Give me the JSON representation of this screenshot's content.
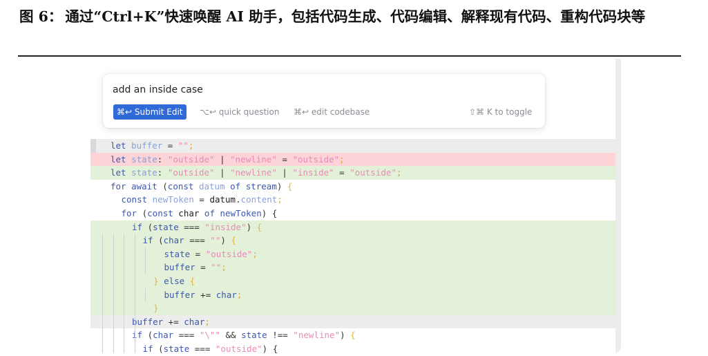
{
  "caption": {
    "prefix": "图 6：",
    "text": "通过“Ctrl+K”快速唤醒 AI 助手，包括代码生成、代码编辑、解释现有代码、重构代码块等"
  },
  "prompt": {
    "input_value": "add an inside case",
    "submit_label": "⌘↩ Submit Edit",
    "quick_question": "⌥↩ quick question",
    "edit_codebase": "⌘↩ edit codebase",
    "toggle_hint": "⇧⌘ K to toggle"
  },
  "code_lines": [
    {
      "bg": "gray",
      "indent": 0,
      "gutter": true,
      "guides": 0,
      "tokens": [
        [
          "kw",
          "let "
        ],
        [
          "var",
          "buffer"
        ],
        [
          "op",
          " = "
        ],
        [
          "str",
          "\"\""
        ],
        [
          "punct",
          ";"
        ]
      ]
    },
    {
      "bg": "red",
      "indent": 0,
      "gutter": false,
      "guides": 0,
      "tokens": [
        [
          "kw",
          "let "
        ],
        [
          "var",
          "state"
        ],
        [
          "op",
          ": "
        ],
        [
          "str",
          "\"outside\""
        ],
        [
          "op",
          " | "
        ],
        [
          "str",
          "\"newline\""
        ],
        [
          "op",
          " = "
        ],
        [
          "str",
          "\"outside\""
        ],
        [
          "punct",
          ";"
        ]
      ]
    },
    {
      "bg": "green",
      "indent": 0,
      "gutter": false,
      "guides": 0,
      "tokens": [
        [
          "kw",
          "let "
        ],
        [
          "var",
          "state"
        ],
        [
          "op",
          ": "
        ],
        [
          "str",
          "\"outside\""
        ],
        [
          "op",
          " | "
        ],
        [
          "str",
          "\"newline\""
        ],
        [
          "op",
          " | "
        ],
        [
          "str",
          "\"inside\""
        ],
        [
          "op",
          " = "
        ],
        [
          "str",
          "\"outside\""
        ],
        [
          "punct",
          ";"
        ]
      ]
    },
    {
      "bg": "plain",
      "indent": 0,
      "gutter": false,
      "guides": 0,
      "tokens": [
        [
          "kw",
          "for await "
        ],
        [
          "op",
          "("
        ],
        [
          "kw",
          "const "
        ],
        [
          "var",
          "datum"
        ],
        [
          "kw",
          " of "
        ],
        [
          "kw",
          "stream"
        ],
        [
          "op",
          ") "
        ],
        [
          "brace",
          "{"
        ]
      ]
    },
    {
      "bg": "plain",
      "indent": 1,
      "gutter": false,
      "guides": 0,
      "tokens": [
        [
          "kw",
          "const "
        ],
        [
          "var",
          "newToken"
        ],
        [
          "op",
          " = "
        ],
        [
          "id",
          "datum"
        ],
        [
          "op",
          "."
        ],
        [
          "var",
          "content"
        ],
        [
          "punct",
          ";"
        ]
      ]
    },
    {
      "bg": "plain",
      "indent": 1,
      "gutter": false,
      "guides": 0,
      "tokens": [
        [
          "kw",
          "for "
        ],
        [
          "op",
          "("
        ],
        [
          "kw",
          "const "
        ],
        [
          "id",
          "char"
        ],
        [
          "kw",
          " of "
        ],
        [
          "kw",
          "newToken"
        ],
        [
          "op",
          ") "
        ],
        [
          "op",
          "{"
        ]
      ]
    },
    {
      "bg": "green",
      "indent": 2,
      "gutter": false,
      "guides": 0,
      "tokens": [
        [
          "kw",
          "if "
        ],
        [
          "op",
          "("
        ],
        [
          "kw",
          "state"
        ],
        [
          "op",
          " === "
        ],
        [
          "str",
          "\"inside\""
        ],
        [
          "op",
          ") "
        ],
        [
          "brace",
          "{"
        ]
      ]
    },
    {
      "bg": "green",
      "indent": 3,
      "gutter": false,
      "guides": 4,
      "tokens": [
        [
          "kw",
          "if "
        ],
        [
          "op",
          "("
        ],
        [
          "kw",
          "char"
        ],
        [
          "op",
          " === "
        ],
        [
          "str",
          "\"\""
        ],
        [
          "op",
          ") "
        ],
        [
          "brace",
          "{"
        ]
      ]
    },
    {
      "bg": "green",
      "indent": 5,
      "gutter": false,
      "guides": 5,
      "tokens": [
        [
          "kw",
          "state"
        ],
        [
          "op",
          " = "
        ],
        [
          "str",
          "\"outside\""
        ],
        [
          "punct",
          ";"
        ]
      ]
    },
    {
      "bg": "green",
      "indent": 5,
      "gutter": false,
      "guides": 5,
      "tokens": [
        [
          "kw",
          "buffer"
        ],
        [
          "op",
          " = "
        ],
        [
          "str",
          "\"\""
        ],
        [
          "punct",
          ";"
        ]
      ]
    },
    {
      "bg": "green",
      "indent": 4,
      "gutter": false,
      "guides": 4,
      "tokens": [
        [
          "brace",
          "} "
        ],
        [
          "kw",
          "else "
        ],
        [
          "brace",
          "{"
        ]
      ]
    },
    {
      "bg": "green",
      "indent": 5,
      "gutter": false,
      "guides": 5,
      "tokens": [
        [
          "kw",
          "buffer"
        ],
        [
          "op",
          " += "
        ],
        [
          "kw",
          "char"
        ],
        [
          "punct",
          ";"
        ]
      ]
    },
    {
      "bg": "green",
      "indent": 4,
      "gutter": false,
      "guides": 4,
      "tokens": [
        [
          "brace",
          "}"
        ]
      ]
    },
    {
      "bg": "gray",
      "indent": 2,
      "gutter": false,
      "guides": 4,
      "tokens": [
        [
          "kw",
          "buffer"
        ],
        [
          "op",
          " += "
        ],
        [
          "kw",
          "char"
        ],
        [
          "punct",
          ";"
        ]
      ]
    },
    {
      "bg": "plain",
      "indent": 2,
      "gutter": false,
      "guides": 4,
      "tokens": [
        [
          "kw",
          "if "
        ],
        [
          "op",
          "("
        ],
        [
          "kw",
          "char"
        ],
        [
          "op",
          " === "
        ],
        [
          "str",
          "\"\\\"\""
        ],
        [
          "op",
          " && "
        ],
        [
          "kw",
          "state"
        ],
        [
          "op",
          " !== "
        ],
        [
          "str",
          "\"newline\""
        ],
        [
          "op",
          ") "
        ],
        [
          "brace",
          "{"
        ]
      ]
    },
    {
      "bg": "plain",
      "indent": 3,
      "gutter": false,
      "guides": 4,
      "tokens": [
        [
          "kw",
          "if "
        ],
        [
          "op",
          "("
        ],
        [
          "kw",
          "state"
        ],
        [
          "op",
          " === "
        ],
        [
          "str",
          "\"outside\""
        ],
        [
          "op",
          ") "
        ],
        [
          "op",
          "{"
        ]
      ]
    }
  ]
}
